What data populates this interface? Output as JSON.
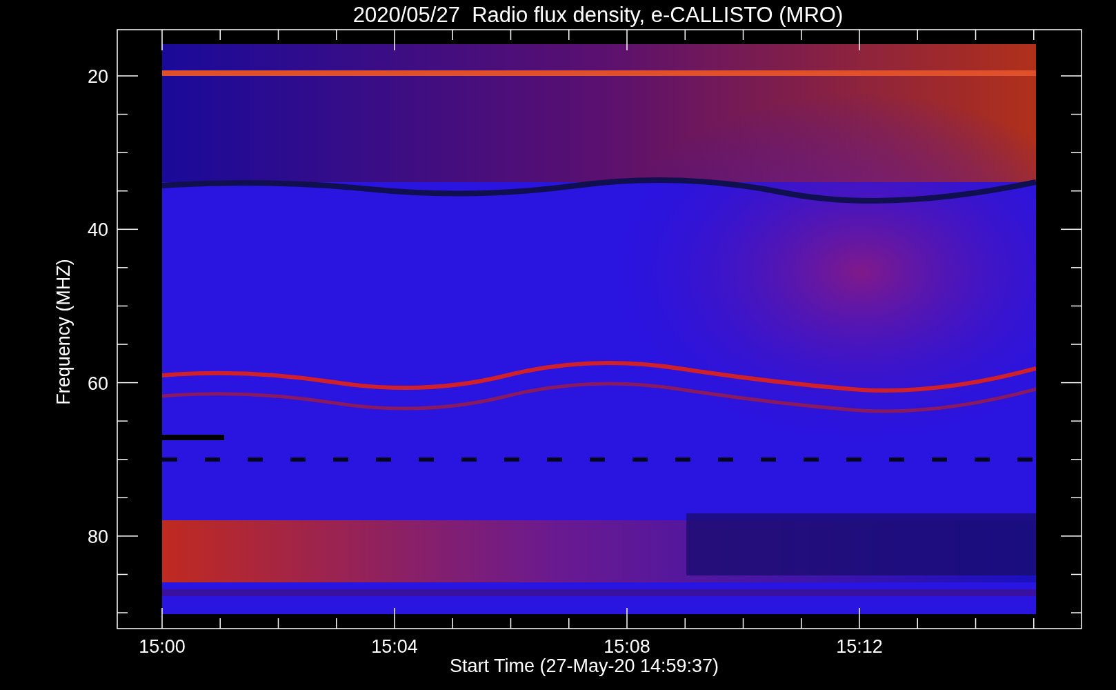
{
  "title": "2020/05/27  Radio flux density, e-CALLISTO (MRO)",
  "y_axis": {
    "label": "Frequency (MHZ)",
    "ticks": [
      "20",
      "40",
      "60",
      "80"
    ]
  },
  "x_axis": {
    "label": "Start Time (27-May-20 14:59:37)",
    "ticks": [
      "15:00",
      "15:04",
      "15:08",
      "15:12"
    ]
  }
}
